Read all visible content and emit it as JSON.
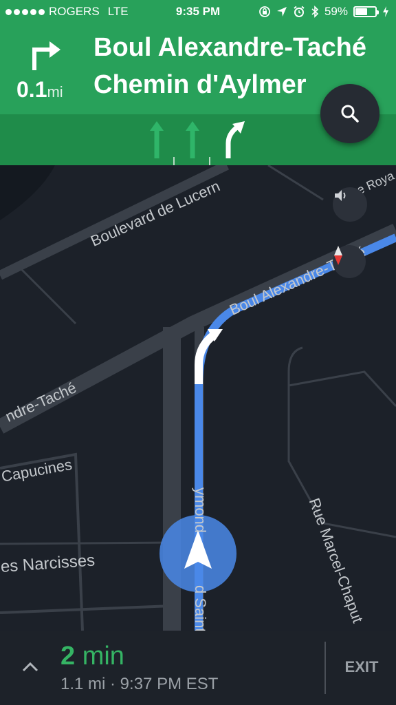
{
  "status_bar": {
    "carrier": "ROGERS",
    "network": "LTE",
    "time": "9:35 PM",
    "battery_percent_label": "59%",
    "battery_level": 0.59,
    "icons": [
      "orientation-lock-icon",
      "location-arrow-icon",
      "alarm-icon",
      "bluetooth-icon",
      "charging-icon"
    ]
  },
  "navigation": {
    "turn_direction": "turn-right-icon",
    "distance_value": "0.1",
    "distance_unit": "mi",
    "street_primary": "Boul Alexandre-Taché",
    "street_secondary": "Chemin d'Aylmer",
    "lanes": [
      "straight",
      "straight",
      "slight-right"
    ],
    "active_lane": 2
  },
  "map": {
    "labels": {
      "boulevard_lucerne": "Boulevard de Lucern",
      "royal": "e Roya",
      "boul_alexandre_tache": "Boul Alexandre-Taché",
      "alexandre_tache_left": "ndre-Taché",
      "capucines": "Capucines",
      "narcisses": "es Narcisses",
      "saint_raymond_top": "ymond",
      "saint_raymond_bottom": "d Saint-",
      "marcel_chaput": "Rue Marcel-Chaput"
    }
  },
  "trip": {
    "eta_minutes": "2",
    "eta_unit": "min",
    "details": "1.1 mi · 9:37 PM EST",
    "exit_label": "EXIT"
  },
  "colors": {
    "header_green": "#28a15a",
    "lane_green": "#1f8c4a",
    "route_blue": "#4a88e8",
    "eta_green": "#35b464",
    "map_bg": "#1c2129"
  }
}
